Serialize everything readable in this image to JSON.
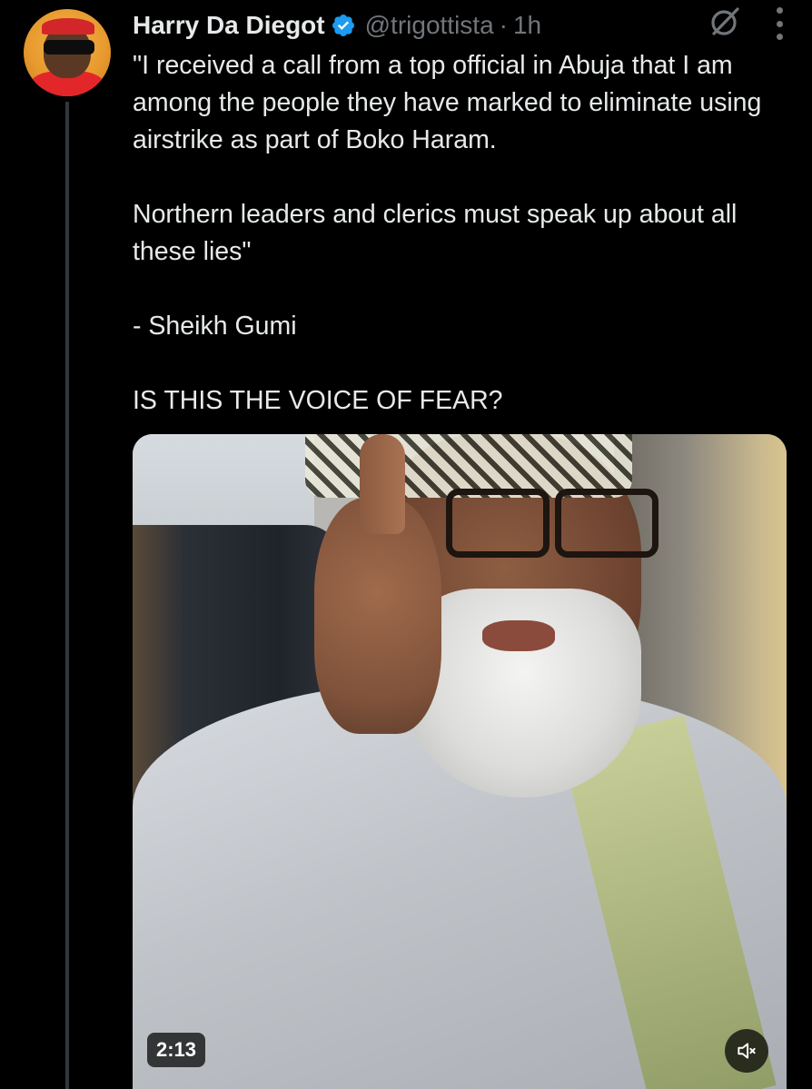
{
  "author": {
    "name": "Harry Da Diegot",
    "handle": "@trigottista",
    "separator": "·",
    "time": "1h",
    "verified": true
  },
  "tweet": {
    "paragraphs": [
      "\"I received a call from a top official in Abuja that I am among the people they have marked to eliminate using airstrike as part of Boko Haram.",
      "Northern leaders and clerics must speak up about all these lies\"",
      "- Sheikh Gumi",
      "IS THIS THE VOICE OF FEAR?"
    ]
  },
  "video": {
    "duration": "2:13",
    "muted": true
  },
  "icons": {
    "verified": "verified-badge-icon",
    "grok": "grok-icon",
    "more": "more-options-icon",
    "mute": "speaker-muted-icon"
  },
  "colors": {
    "background": "#000000",
    "text": "#e7e9ea",
    "secondary_text": "#71767b",
    "verified_blue": "#1d9bf0",
    "thread_line": "#333639"
  }
}
